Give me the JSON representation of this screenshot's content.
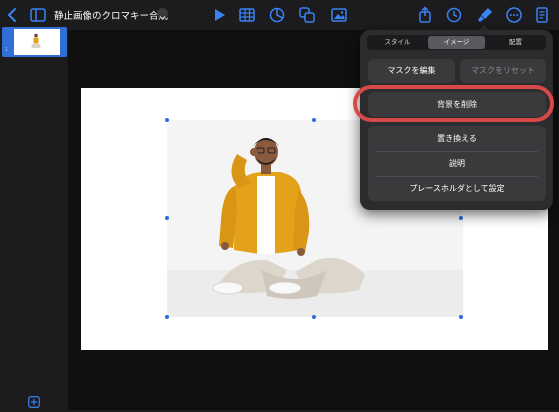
{
  "toolbar": {
    "title": "静止画像のクロマキー合成",
    "accent_color": "#3b82f6"
  },
  "sidebar": {
    "slide_number": "1"
  },
  "format_panel": {
    "tabs": [
      "スタイル",
      "イメージ",
      "配置"
    ],
    "active_tab": "イメージ",
    "edit_mask_label": "マスクを編集",
    "reset_mask_label": "マスクをリセット",
    "remove_background_label": "背景を削除",
    "replace_label": "置き換える",
    "description_label": "説明",
    "placeholder_label": "プレースホルダとして設定"
  },
  "colors": {
    "highlight": "#d94848",
    "selection": "#2d6cdf",
    "jacket": "#e3a21a"
  }
}
